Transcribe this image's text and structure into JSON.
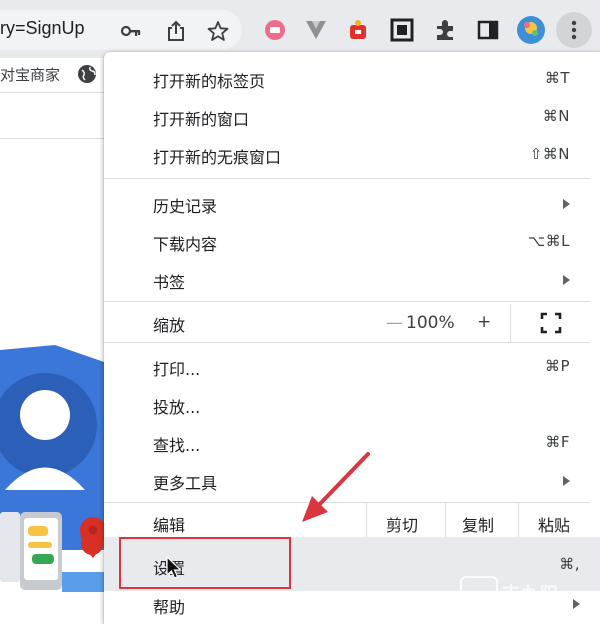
{
  "browser": {
    "url_fragment": "ry=SignUp",
    "bookmark_label": "对宝商家",
    "icons": [
      "key-icon",
      "share-icon",
      "star-icon",
      "extension-icon-pink",
      "extension-icon-v",
      "extension-icon-red",
      "qr-icon",
      "puzzle-icon",
      "sidebar-icon",
      "profile-avatar",
      "kebab-menu-icon"
    ]
  },
  "menu": {
    "new_tab": {
      "label": "打开新的标签页",
      "shortcut": "⌘T"
    },
    "new_window": {
      "label": "打开新的窗口",
      "shortcut": "⌘N"
    },
    "new_incognito": {
      "label": "打开新的无痕窗口",
      "shortcut": "⇧⌘N"
    },
    "history": {
      "label": "历史记录"
    },
    "downloads": {
      "label": "下载内容",
      "shortcut": "⌥⌘L"
    },
    "bookmarks": {
      "label": "书签"
    },
    "zoom": {
      "label": "缩放",
      "minus": "—",
      "value": "100%",
      "plus": "+"
    },
    "print": {
      "label": "打印...",
      "shortcut": "⌘P"
    },
    "cast": {
      "label": "投放..."
    },
    "find": {
      "label": "查找...",
      "shortcut": "⌘F"
    },
    "more_tools": {
      "label": "更多工具"
    },
    "edit": {
      "label": "编辑",
      "cut": "剪切",
      "copy": "复制",
      "paste": "粘贴"
    },
    "settings": {
      "label": "设置",
      "shortcut": "⌘,"
    },
    "help": {
      "label": "帮助"
    }
  },
  "watermark": "吉九阳",
  "colors": {
    "highlight": "#d9363e",
    "accent_blue": "#4a84d6"
  }
}
